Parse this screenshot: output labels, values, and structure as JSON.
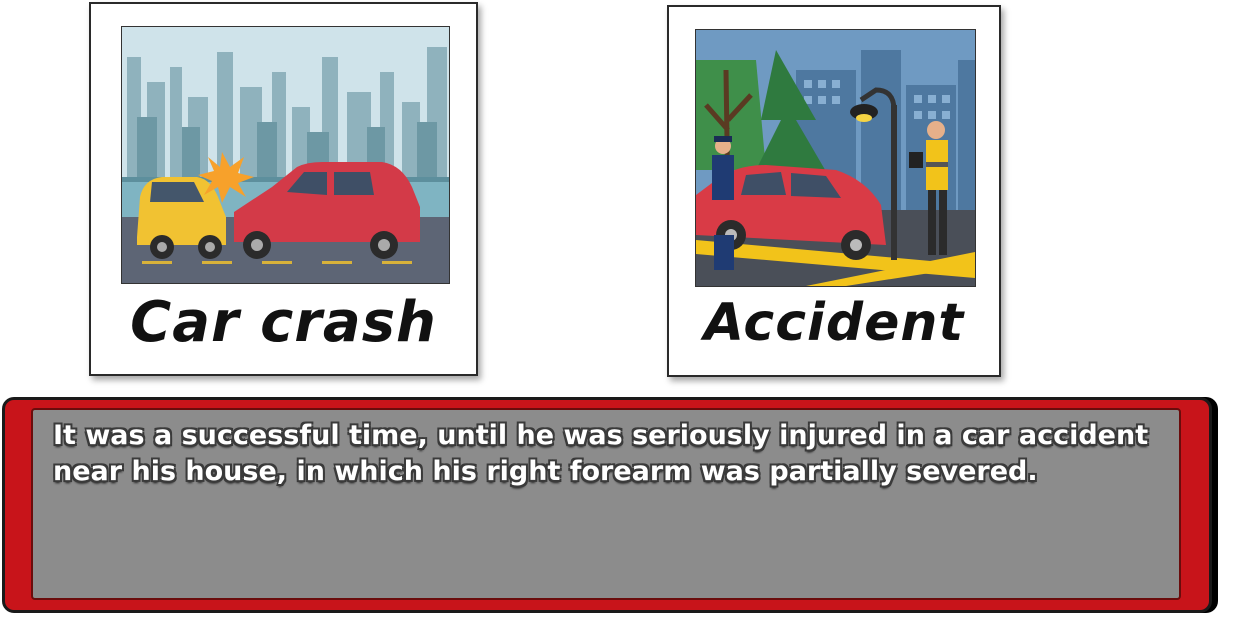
{
  "cards": [
    {
      "caption": "Car crash",
      "image": "car-crash-illustration"
    },
    {
      "caption": "Accident",
      "image": "accident-scene-illustration"
    }
  ],
  "dialog": {
    "text": "It was a successful time, until he was seriously injured in a car accident near his house, in which his right forearm was partially severed."
  },
  "colors": {
    "dialog_frame": "#c8141a",
    "dialog_panel": "#8c8c8c",
    "text": "#ffffff"
  }
}
